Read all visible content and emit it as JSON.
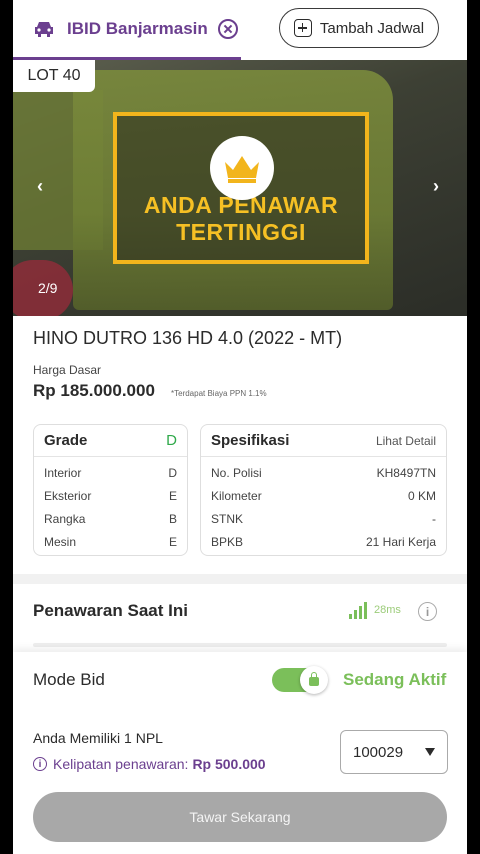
{
  "header": {
    "venue_name": "IBID Banjarmasin",
    "add_schedule_label": "Tambah Jadwal"
  },
  "photo": {
    "lot_label": "LOT 40",
    "badge_line1": "ANDA PENAWAR",
    "badge_line2": "TERTINGGI",
    "counter": "2/9",
    "prev": "‹",
    "next": "›"
  },
  "vehicle": {
    "title": "HINO DUTRO 136 HD 4.0 (2022 - MT)",
    "price_label": "Harga Dasar",
    "price": "Rp 185.000.000",
    "price_note": "*Terdapat Biaya PPN 1.1%"
  },
  "grade_card": {
    "title": "Grade",
    "overall": "D",
    "rows": [
      {
        "label": "Interior",
        "value": "D"
      },
      {
        "label": "Eksterior",
        "value": "E"
      },
      {
        "label": "Rangka",
        "value": "B"
      },
      {
        "label": "Mesin",
        "value": "E"
      }
    ]
  },
  "spec_card": {
    "title": "Spesifikasi",
    "detail_link": "Lihat Detail",
    "rows": [
      {
        "label": "No. Polisi",
        "value": "KH8497TN"
      },
      {
        "label": "Kilometer",
        "value": "0 KM"
      },
      {
        "label": "STNK",
        "value": "-"
      },
      {
        "label": "BPKB",
        "value": "21 Hari Kerja"
      }
    ]
  },
  "offer": {
    "title": "Penawaran Saat Ini",
    "latency": "28ms",
    "info_icon": "i"
  },
  "bid_panel": {
    "mode_label": "Mode Bid",
    "status": "Sedang Aktif",
    "npl_text": "Anda Memiliki 1 NPL",
    "multiple_label": "Kelipatan penawaran:",
    "multiple_amount": "Rp 500.000",
    "npl_select_value": "100029",
    "bid_button": "Tawar Sekarang"
  },
  "colors": {
    "brand": "#6b3f8f",
    "active_green": "#7bbf5a",
    "badge_gold": "#f2b51c"
  }
}
